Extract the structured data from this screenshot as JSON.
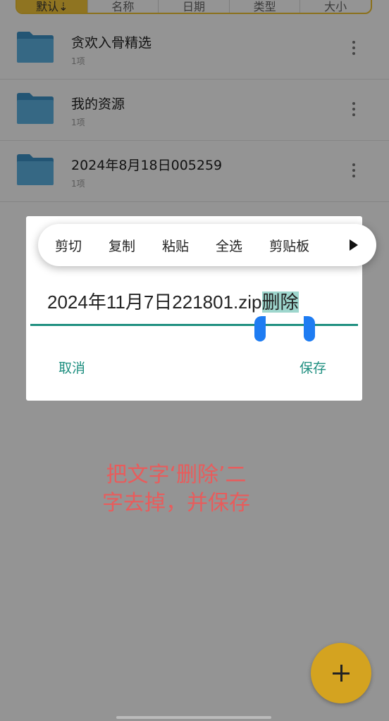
{
  "sort_bar": {
    "tabs": [
      "默认⇣",
      "名称",
      "日期",
      "类型",
      "大小"
    ]
  },
  "files": [
    {
      "name": "贪欢入骨精选",
      "meta": "1项"
    },
    {
      "name": "我的资源",
      "meta": "1项"
    },
    {
      "name": "2024年8月18日005259",
      "meta": "1项"
    }
  ],
  "context_menu": {
    "items": [
      "剪切",
      "复制",
      "粘贴",
      "全选",
      "剪贴板"
    ]
  },
  "rename_dialog": {
    "text_before": "2024年11月7日221801.zip",
    "text_selected": "删除",
    "cancel_label": "取消",
    "save_label": "保存"
  },
  "hint": {
    "line1": "把文字‘删除’二",
    "line2": "字去掉，并保存"
  },
  "colors": {
    "accent_teal": "#1f8f80",
    "fab_yellow": "#d4a320",
    "folder_blue": "#4aa3d8",
    "hint_red": "#e85c5c"
  }
}
